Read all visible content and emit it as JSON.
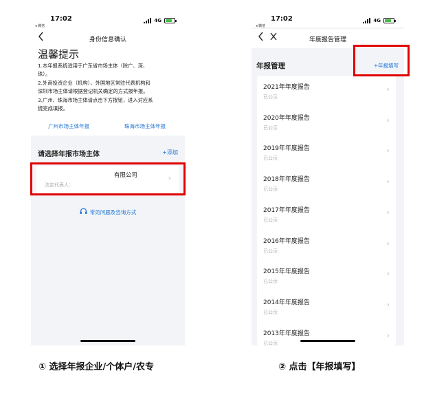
{
  "phone1": {
    "status": {
      "time": "17:02",
      "back_app": "◂ 微信",
      "network": "4G"
    },
    "nav": {
      "title": "身份信息确认"
    },
    "tips": {
      "title": "温馨提示",
      "line1": "1.本年报系统适用于广东省市场主体（除广、深、",
      "line2": "珠）。",
      "line3": "2.外商投资企业（机构）、外国地区常驻代表机构和",
      "line4": "深圳市场主体请根据登记机关确定的方式报年报。",
      "line5": "3.广州、珠海市场主体请点击下方按钮，进入对应系",
      "line6": "统完成填报。"
    },
    "links": {
      "guangzhou": "广州市场主体年报",
      "zhuhai": "珠海市场主体年报"
    },
    "section": {
      "title": "请选择年报市场主体",
      "add": "+添加"
    },
    "entity": {
      "name": "有限公司",
      "rep": "法定代表人："
    },
    "faq": "常见问题及咨询方式"
  },
  "phone2": {
    "status": {
      "time": "17:02",
      "back_app": "◂ 微信",
      "network": "4G"
    },
    "nav": {
      "title": "年度报告管理"
    },
    "section": {
      "title": "年报管理",
      "fill": "+年报填写"
    },
    "reports": [
      {
        "title": "2021年年度报告",
        "status": "已公示"
      },
      {
        "title": "2020年年度报告",
        "status": "已公示"
      },
      {
        "title": "2019年年度报告",
        "status": "已公示"
      },
      {
        "title": "2018年年度报告",
        "status": "已公示"
      },
      {
        "title": "2017年年度报告",
        "status": "已公示"
      },
      {
        "title": "2016年年度报告",
        "status": "已公示"
      },
      {
        "title": "2015年年度报告",
        "status": "已公示"
      },
      {
        "title": "2014年年度报告",
        "status": "已公示"
      },
      {
        "title": "2013年年度报告",
        "status": "已公示"
      }
    ]
  },
  "captions": {
    "step1": "① 选择年报企业/个体户/农专",
    "step2": "② 点击【年报填写】"
  },
  "icons": {
    "back": "chevron-left-icon",
    "close": "close-icon",
    "chevron": "chevron-right-icon",
    "faq": "headset-icon"
  },
  "colors": {
    "highlight": "#e00000",
    "link": "#1f74d6",
    "background": "#f2f4f7"
  }
}
